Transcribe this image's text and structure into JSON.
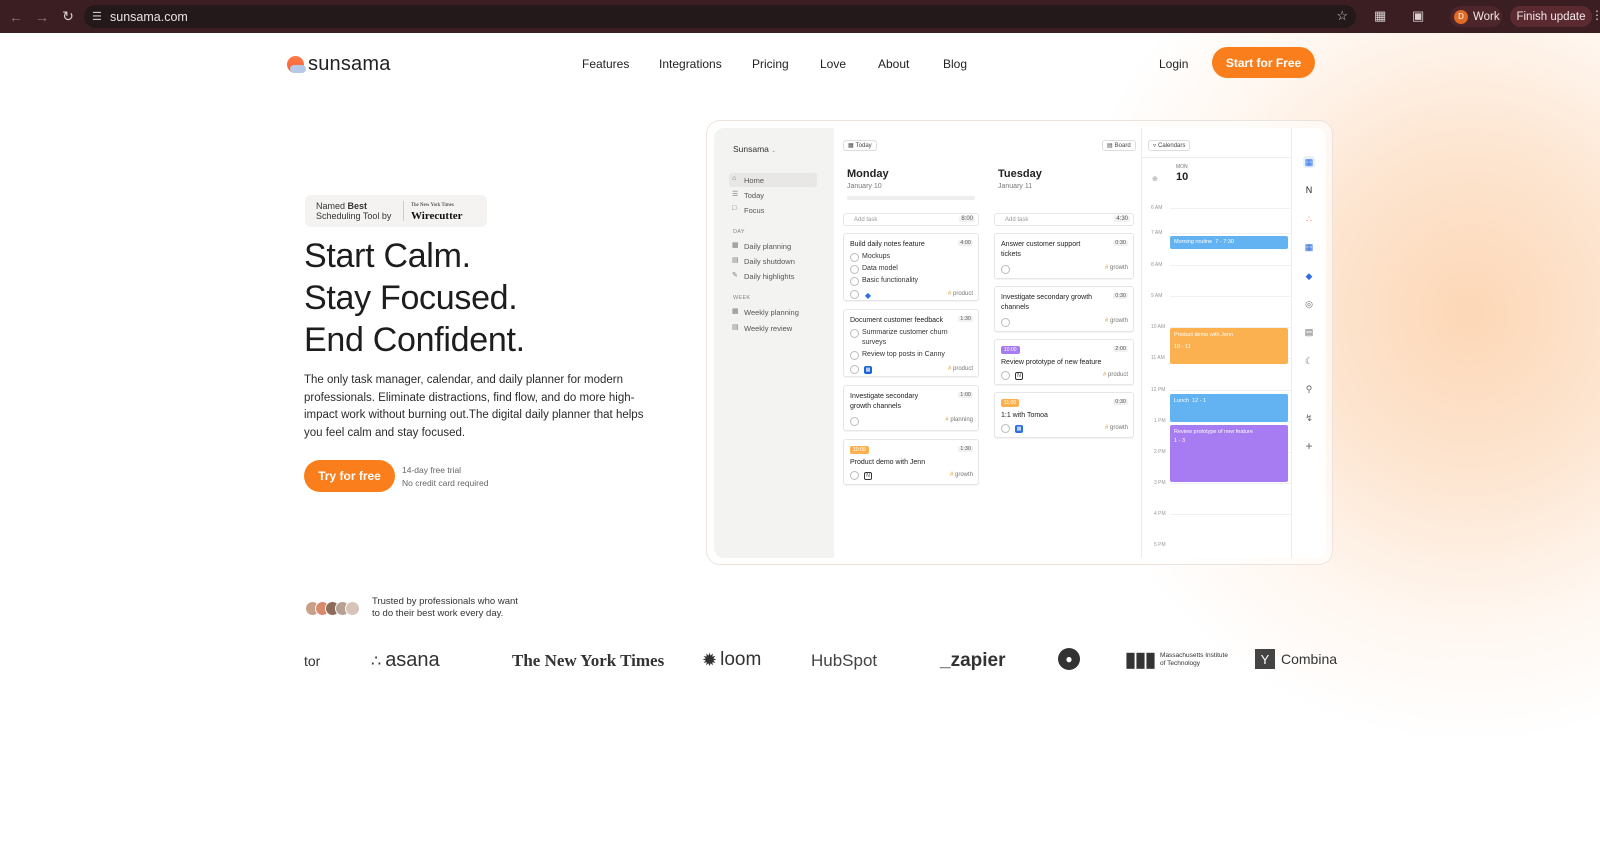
{
  "browser": {
    "url": "sunsama.com",
    "profile_initial": "D",
    "profile_label": "Work",
    "update_label": "Finish update"
  },
  "nav": {
    "logo": "sunsama",
    "items": [
      "Features",
      "Integrations",
      "Pricing",
      "Love",
      "About",
      "Blog"
    ],
    "login": "Login",
    "cta": "Start for Free"
  },
  "hero": {
    "badge_line1": "Named",
    "badge_bold1": "Best",
    "badge_line2": "Scheduling Tool by",
    "badge_sponsor_small": "The New York Times",
    "badge_sponsor": "Wirecutter",
    "headline": [
      "Start Calm.",
      "Stay Focused.",
      "End Confident."
    ],
    "description": "The only task manager, calendar, and daily planner for modern professionals. Eliminate distractions, find flow, and do more high-impact work without burning out.The digital daily planner that helps you feel calm and stay focused.",
    "try_button": "Try for free",
    "trial_line1": "14-day free trial",
    "trial_line2": "No credit card required"
  },
  "app": {
    "workspace": "Sunsama",
    "sidebar": {
      "main": [
        "Home",
        "Today",
        "Focus"
      ],
      "day_label": "DAY",
      "day_items": [
        "Daily planning",
        "Daily shutdown",
        "Daily highlights"
      ],
      "week_label": "WEEK",
      "week_items": [
        "Weekly planning",
        "Weekly review"
      ]
    },
    "today_button": "Today",
    "board_button": "Board",
    "calendars_button": "Calendars",
    "add_task": "Add task",
    "monday": {
      "day": "Monday",
      "date": "January 10",
      "add_time": "8:00",
      "tasks": [
        {
          "title": "Build daily notes feature",
          "dur": "4:00",
          "subs": [
            "Mockups",
            "Data model",
            "Basic functionality"
          ],
          "tag": "product"
        },
        {
          "title": "Document customer feedback",
          "dur": "1:30",
          "subs": [
            "Summarize customer churn surveys",
            "Review top posts in Canny"
          ],
          "tag": "product"
        },
        {
          "title": "Investigate secondary growth channels",
          "dur": "1:00",
          "subs": [],
          "tag": "planning"
        },
        {
          "title": "Product demo with Jenn",
          "dur": "1:30",
          "time": "10:00",
          "subs": [],
          "tag": "growth"
        }
      ]
    },
    "tuesday": {
      "day": "Tuesday",
      "date": "January 11",
      "add_time": "4:30",
      "tasks": [
        {
          "title": "Answer customer support tickets",
          "dur": "0:30",
          "tag": "growth"
        },
        {
          "title": "Investigate secondary growth channels",
          "dur": "0:30",
          "tag": "growth"
        },
        {
          "title": "Review prototype of new feature",
          "dur": "2:00",
          "time": "10:00",
          "tag": "product"
        },
        {
          "title": "1:1 with Tomoa",
          "dur": "0:30",
          "time": "11:00",
          "tag": "growth"
        }
      ]
    },
    "calendar": {
      "dow": "MON",
      "day_num": "10",
      "hours": [
        "6 AM",
        "7 AM",
        "8 AM",
        "9 AM",
        "10 AM",
        "11 AM",
        "12 PM",
        "1 PM",
        "2 PM",
        "3 PM",
        "4 PM",
        "5 PM"
      ],
      "events": [
        {
          "title": "Morning routine",
          "time": "7 - 7:30",
          "color": "#63b3f2"
        },
        {
          "title": "Product demo with Jenn",
          "time": "10 - 11",
          "color": "#fbb14f"
        },
        {
          "title": "Lunch",
          "time": "12 - 1",
          "color": "#63b3f2"
        },
        {
          "title": "Review prototype of new feature",
          "time": "1 - 3",
          "color": "#a77cf2"
        }
      ]
    }
  },
  "trust": {
    "line1": "Trusted by professionals who want",
    "line2": "to do their best work every day."
  },
  "logos": [
    "tor",
    "asana",
    "The New York Times",
    "loom",
    "HubSpot",
    "_zapier",
    "Massachusetts Institute of Technology",
    "Combina"
  ],
  "colors": {
    "accent": "#fa7f1c",
    "chrome": "#3a1e22"
  }
}
